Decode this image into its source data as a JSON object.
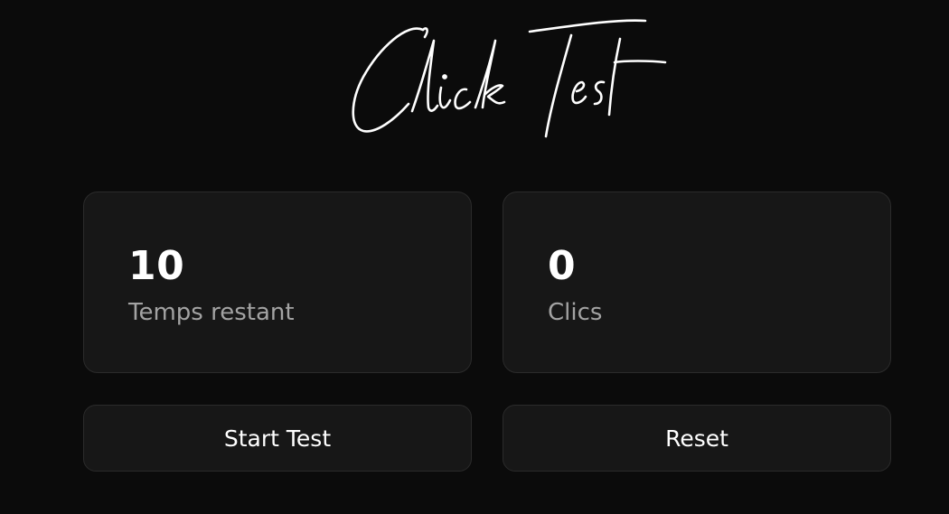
{
  "header": {
    "title": "Click Test"
  },
  "stats": {
    "time_remaining": {
      "value": "10",
      "label": "Temps restant"
    },
    "clicks": {
      "value": "0",
      "label": "Clics"
    }
  },
  "actions": {
    "start_label": "Start Test",
    "reset_label": "Reset"
  },
  "colors": {
    "background": "#0b0b0b",
    "card": "#171717",
    "border": "#2b2b2b",
    "text": "#ffffff",
    "muted_text": "#a3a3a3"
  }
}
